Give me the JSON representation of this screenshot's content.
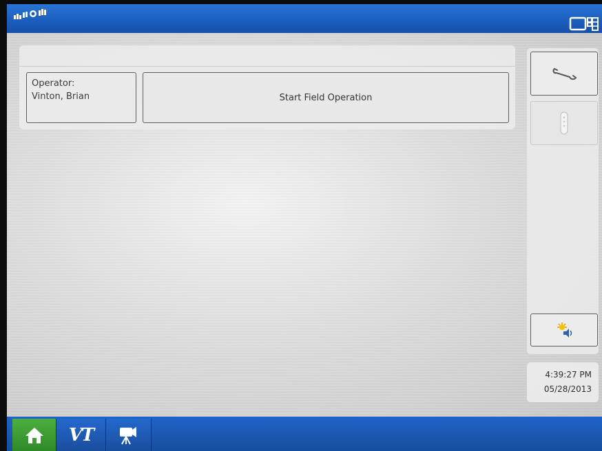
{
  "operator": {
    "label": "Operator:",
    "name": "Vinton, Brian"
  },
  "main": {
    "start_label": "Start Field Operation"
  },
  "sidebar": {
    "buttons": [
      {
        "icon": "wrench-icon"
      },
      {
        "icon": "device-icon",
        "enabled": false
      },
      {
        "icon": "display-settings-icon"
      }
    ]
  },
  "clock": {
    "time": "4:39:27 PM",
    "date": "05/28/2013"
  },
  "bottom_nav": {
    "tabs": [
      {
        "icon": "home-icon",
        "active": true
      },
      {
        "label": "VT",
        "icon": "vt-icon"
      },
      {
        "icon": "camera-icon"
      }
    ]
  },
  "colors": {
    "top_bar": "#1c5fbf",
    "active_tab": "#3d9c33",
    "body": "#dcdcdc"
  }
}
